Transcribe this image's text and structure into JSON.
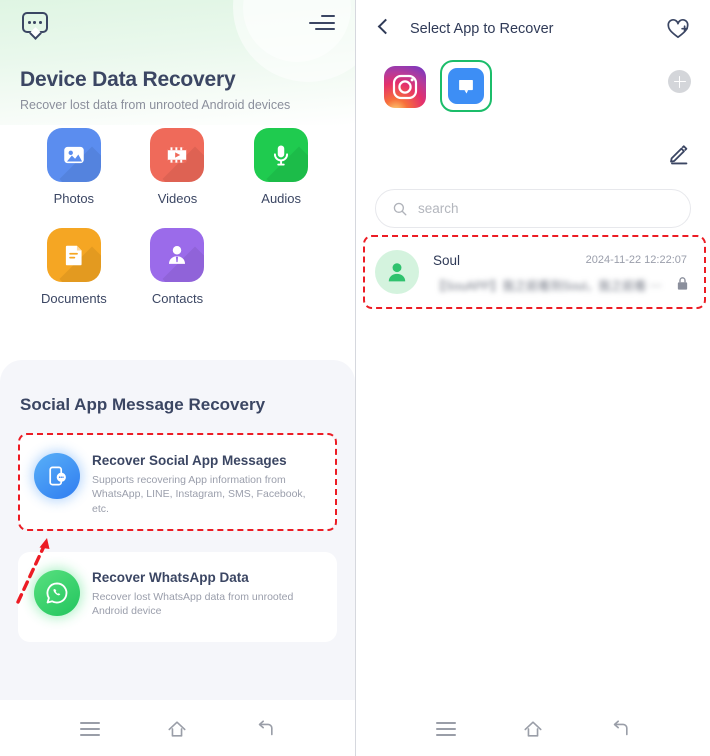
{
  "left": {
    "header": {
      "chat_icon": "chat-bubble-icon",
      "menu_icon": "hamburger-menu-icon"
    },
    "hero": {
      "title": "Device Data Recovery",
      "subtitle": "Recover lost data from unrooted Android devices"
    },
    "data_types": [
      {
        "label": "Photos",
        "icon": "photo-icon",
        "color": "#5b8def"
      },
      {
        "label": "Videos",
        "icon": "video-icon",
        "color": "#ef6a5a"
      },
      {
        "label": "Audios",
        "icon": "microphone-icon",
        "color": "#1fcb4f"
      },
      {
        "label": "Documents",
        "icon": "document-icon",
        "color": "#f5a623"
      },
      {
        "label": "Contacts",
        "icon": "contact-icon",
        "color": "#9b6bea"
      }
    ],
    "social": {
      "section_title": "Social App Message Recovery",
      "cards": [
        {
          "title": "Recover Social App Messages",
          "desc": "Supports recovering App information from WhatsApp, LINE, Instagram, SMS, Facebook, etc.",
          "icon": "social-message-icon",
          "color": "#3d8ef5",
          "highlighted": "true"
        },
        {
          "title": "Recover WhatsApp Data",
          "desc": "Recover lost WhatsApp data from unrooted Android device",
          "icon": "whatsapp-icon",
          "color": "#3ed672",
          "highlighted": "false"
        }
      ]
    },
    "navbar": {
      "menu": "menu-nav-icon",
      "home": "home-nav-icon",
      "back": "back-nav-icon"
    }
  },
  "right": {
    "header": {
      "back_icon": "back-chevron-icon",
      "title": "Select App to Recover",
      "favorite_icon": "heart-plus-icon"
    },
    "apps": [
      {
        "name": "Instagram",
        "icon": "instagram-icon",
        "selected": "false"
      },
      {
        "name": "Messages",
        "icon": "messages-icon",
        "selected": "true"
      }
    ],
    "add_app_label": "+",
    "edit_icon": "edit-pencil-icon",
    "search": {
      "placeholder": "search",
      "value": "",
      "icon": "search-icon"
    },
    "contacts": [
      {
        "name": "Soul",
        "timestamp": "2024-11-22 12:22:07",
        "message_visible": "【S",
        "message_redacted": "ouAPP】我之前看到Soul，我之前看 ⋯",
        "avatar": "person-avatar-icon",
        "lock": "lock-icon",
        "highlighted": "true"
      }
    ],
    "navbar": {
      "menu": "menu-nav-icon",
      "home": "home-nav-icon",
      "back": "back-nav-icon"
    }
  },
  "annotations": {
    "highlight_color": "#ec1c24",
    "arrow": "red-dashed-arrow",
    "boxes": [
      "recover-social-app-messages-card",
      "soul-contact-row"
    ]
  }
}
